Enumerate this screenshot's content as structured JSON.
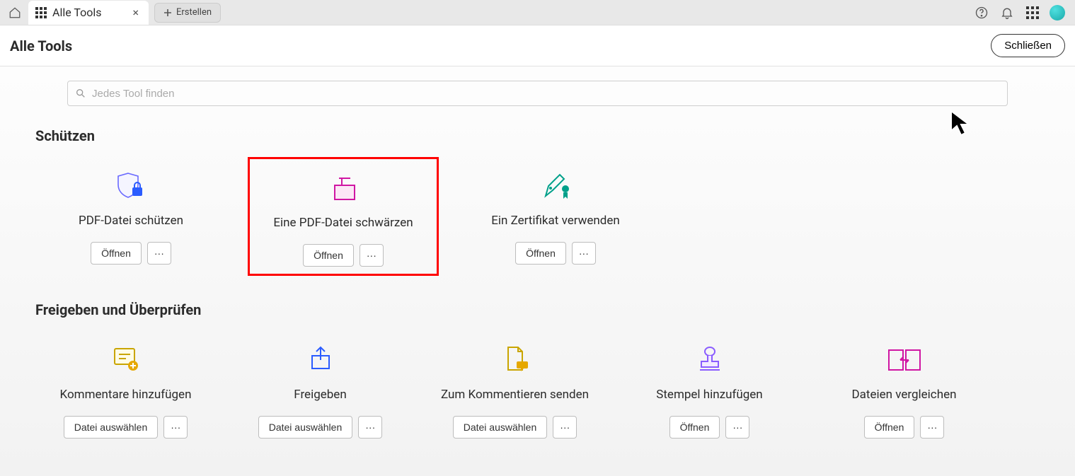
{
  "topbar": {
    "tab_label": "Alle Tools",
    "create_label": "Erstellen"
  },
  "header": {
    "title": "Alle Tools",
    "close_label": "Schließen"
  },
  "search": {
    "placeholder": "Jedes Tool finden"
  },
  "sections": {
    "protect": {
      "title": "Schützen",
      "tools": [
        {
          "label": "PDF-Datei schützen",
          "action": "Öffnen"
        },
        {
          "label": "Eine PDF-Datei schwärzen",
          "action": "Öffnen"
        },
        {
          "label": "Ein Zertifikat verwenden",
          "action": "Öffnen"
        }
      ]
    },
    "share": {
      "title": "Freigeben und Überprüfen",
      "tools": [
        {
          "label": "Kommentare hinzufügen",
          "action": "Datei auswählen"
        },
        {
          "label": "Freigeben",
          "action": "Datei auswählen"
        },
        {
          "label": "Zum Kommentieren senden",
          "action": "Datei auswählen"
        },
        {
          "label": "Stempel hinzufügen",
          "action": "Öffnen"
        },
        {
          "label": "Dateien vergleichen",
          "action": "Öffnen"
        }
      ]
    }
  }
}
